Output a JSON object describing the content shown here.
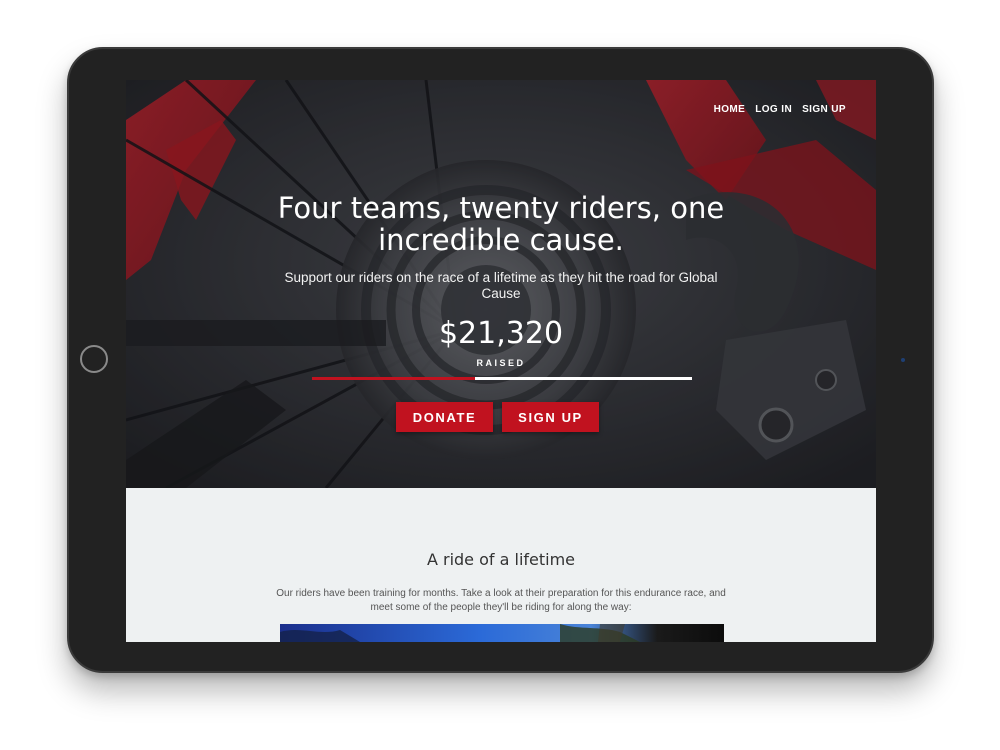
{
  "nav": {
    "items": [
      {
        "label": "HOME"
      },
      {
        "label": "LOG IN"
      },
      {
        "label": "SIGN UP"
      }
    ]
  },
  "hero": {
    "title": "Four teams, twenty riders, one incredible cause.",
    "subtitle": "Support our riders on the race of a lifetime as they hit the road for Global Cause",
    "amount": "$21,320",
    "amount_label": "RAISED",
    "progress_fraction": 0.43,
    "donate_label": "DONATE",
    "signup_label": "SIGN UP",
    "background_image": "bicycle-rear-cassette-photo"
  },
  "section": {
    "title": "A ride of a lifetime",
    "body": "Our riders have been training for months. Take a look at their preparation for this endurance race, and meet some of the people they'll be riding for along the way:",
    "media": "video-thumbnail"
  },
  "colors": {
    "accent": "#c1121f",
    "section_bg": "#eef1f2",
    "device_frame": "#222222"
  }
}
